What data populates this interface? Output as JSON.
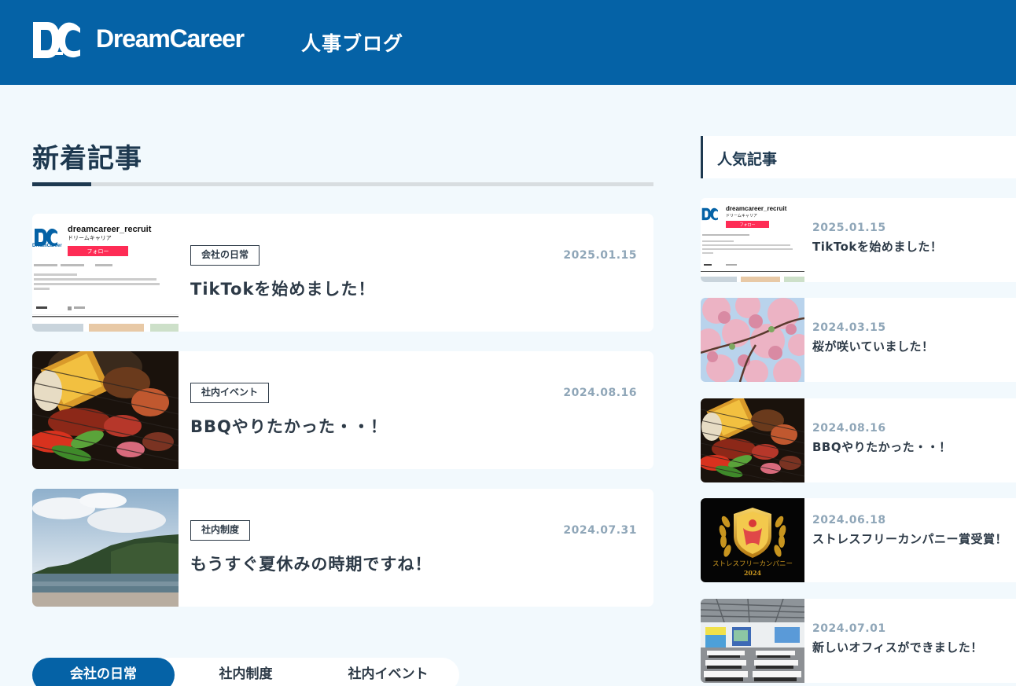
{
  "header": {
    "brand": "DreamCareer",
    "blog_title": "人事ブログ",
    "brand_color": "#0562a6"
  },
  "main": {
    "section_title": "新着記事",
    "articles": [
      {
        "category": "会社の日常",
        "date": "2025.01.15",
        "title": "TikTokを始めました！",
        "thumb": "tiktok-profile-screenshot"
      },
      {
        "category": "社内イベント",
        "date": "2024.08.16",
        "title": "BBQやりたかった・・！",
        "thumb": "bbq-grill-photo"
      },
      {
        "category": "社内制度",
        "date": "2024.07.31",
        "title": "もうすぐ夏休みの時期ですね！",
        "thumb": "beach-photo"
      }
    ],
    "tabs": [
      {
        "label": "会社の日常",
        "active": true
      },
      {
        "label": "社内制度",
        "active": false
      },
      {
        "label": "社内イベント",
        "active": false
      }
    ]
  },
  "tiktok_thumb": {
    "username": "dreamcareer_recruit",
    "display_name": "ドリームキャリア",
    "follow_label": "フォロー",
    "logo_text": "DreamCareer"
  },
  "sidebar": {
    "title": "人気記事",
    "items": [
      {
        "date": "2025.01.15",
        "title": "TikTokを始めました！",
        "thumb": "tiktok-profile-screenshot"
      },
      {
        "date": "2024.03.15",
        "title": "桜が咲いていました！",
        "thumb": "cherry-blossom-photo"
      },
      {
        "date": "2024.08.16",
        "title": "BBQやりたかった・・！",
        "thumb": "bbq-grill-photo"
      },
      {
        "date": "2024.06.18",
        "title": "ストレスフリーカンパニー賞受賞！",
        "thumb": "award-emblem"
      },
      {
        "date": "2024.07.01",
        "title": "新しいオフィスができました！",
        "thumb": "office-interior-photo"
      }
    ]
  },
  "award_thumb": {
    "caption": "ストレスフリーカンパニー",
    "year": "2024"
  }
}
